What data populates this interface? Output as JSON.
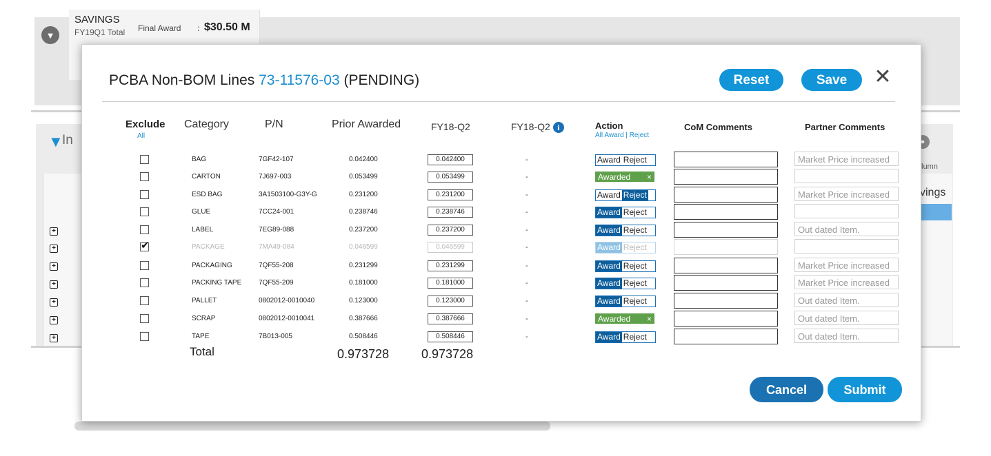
{
  "background": {
    "savings": {
      "title": "SAVINGS",
      "period": "FY19Q1 Total",
      "final_label": "Final Award",
      "colon": ":",
      "value": "$30.50 M"
    },
    "filter_prefix": "In",
    "column_fragment": "lumn",
    "savings_fragment": "vings"
  },
  "modal": {
    "title_prefix": "PCBA Non-BOM Lines",
    "part_number": "73-11576-03",
    "status": "(PENDING)",
    "reset_label": "Reset",
    "save_label": "Save",
    "close_label": "✕",
    "cancel_label": "Cancel",
    "submit_label": "Submit",
    "headers": {
      "exclude": "Exclude",
      "exclude_all": "All",
      "category": "Category",
      "pn": "P/N",
      "prior_awarded": "Prior Awarded",
      "fy18q2": "FY18-Q2",
      "fy18q2_info": "FY18-Q2",
      "action": "Action",
      "all_award": "All Award",
      "sep": "|",
      "reject": "Reject",
      "com_comments": "CoM Comments",
      "partner_comments": "Partner Comments"
    },
    "rows": [
      {
        "category": "BAG",
        "pn": "7GF42-107",
        "prior": "0.042400",
        "fy": "0.042400",
        "q2": "-",
        "partner": "Market Price increased"
      },
      {
        "category": "CARTON",
        "pn": "7J697-003",
        "prior": "0.053499",
        "fy": "0.053499",
        "q2": "-",
        "partner": ""
      },
      {
        "category": "ESD BAG",
        "pn": "3A1503100-G3Y-G",
        "prior": "0.231200",
        "fy": "0.231200",
        "q2": "-",
        "partner": "Market Price increased"
      },
      {
        "category": "GLUE",
        "pn": "7CC24-001",
        "prior": "0.238746",
        "fy": "0.238746",
        "q2": "-",
        "partner": ""
      },
      {
        "category": "LABEL",
        "pn": "7EG89-088",
        "prior": "0.237200",
        "fy": "0.237200",
        "q2": "-",
        "partner": "Out dated Item."
      },
      {
        "category": "PACKAGE",
        "pn": "7MA49-084",
        "prior": "0.046599",
        "fy": "0.046599",
        "q2": "-",
        "partner": ""
      },
      {
        "category": "PACKAGING",
        "pn": "7QF55-208",
        "prior": "0.231299",
        "fy": "0.231299",
        "q2": "-",
        "partner": "Market Price increased"
      },
      {
        "category": "PACKING TAPE",
        "pn": "7QF55-209",
        "prior": "0.181000",
        "fy": "0.181000",
        "q2": "-",
        "partner": "Market Price increased"
      },
      {
        "category": "PALLET",
        "pn": "0802012-0010040",
        "prior": "0.123000",
        "fy": "0.123000",
        "q2": "-",
        "partner": "Out dated Item."
      },
      {
        "category": "SCRAP",
        "pn": "0802012-0010041",
        "prior": "0.387666",
        "fy": "0.387666",
        "q2": "-",
        "partner": "Out dated Item."
      },
      {
        "category": "TAPE",
        "pn": "7B013-005",
        "prior": "0.508446",
        "fy": "0.508446",
        "q2": "-",
        "partner": "Out dated Item."
      }
    ],
    "action_labels": {
      "award": "Award",
      "reject": "Reject",
      "awarded": "Awarded",
      "remove": "×"
    },
    "total_label": "Total",
    "total_prior": "0.973728",
    "total_fy": "0.973728"
  }
}
